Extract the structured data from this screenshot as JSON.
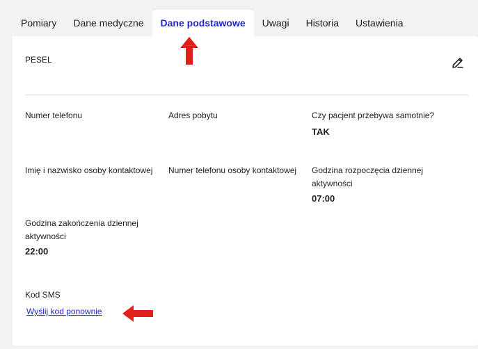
{
  "tabs": [
    {
      "label": "Pomiary"
    },
    {
      "label": "Dane medyczne"
    },
    {
      "label": "Dane podstawowe"
    },
    {
      "label": "Uwagi"
    },
    {
      "label": "Historia"
    },
    {
      "label": "Ustawienia"
    }
  ],
  "active_tab": "Dane podstawowe",
  "fields": {
    "pesel": {
      "label": "PESEL"
    },
    "phone": {
      "label": "Numer telefonu"
    },
    "address": {
      "label": "Adres pobytu"
    },
    "alone": {
      "label": "Czy pacjent przebywa samotnie?",
      "value": "TAK"
    },
    "contact_name": {
      "label": "Imię i nazwisko osoby kontaktowej"
    },
    "contact_phone": {
      "label": "Numer telefonu osoby kontaktowej"
    },
    "activity_start": {
      "label_1": "Godzina rozpoczęcia dziennej",
      "label_2": "aktywności",
      "value": "07:00"
    },
    "activity_end": {
      "label_1": "Godzina zakończenia dziennej",
      "label_2": "aktywności",
      "value": "22:00"
    },
    "sms_code": {
      "label": "Kod SMS",
      "link": "Wyślij kod ponownie"
    }
  },
  "icons": {
    "edit": "pencil-edit-icon",
    "arrow_up": "red-arrow-up",
    "arrow_left": "red-arrow-left"
  },
  "colors": {
    "accent": "#1e2bc8",
    "annotation": "#e0201b",
    "background": "#f2f2f4",
    "card": "#ffffff"
  }
}
